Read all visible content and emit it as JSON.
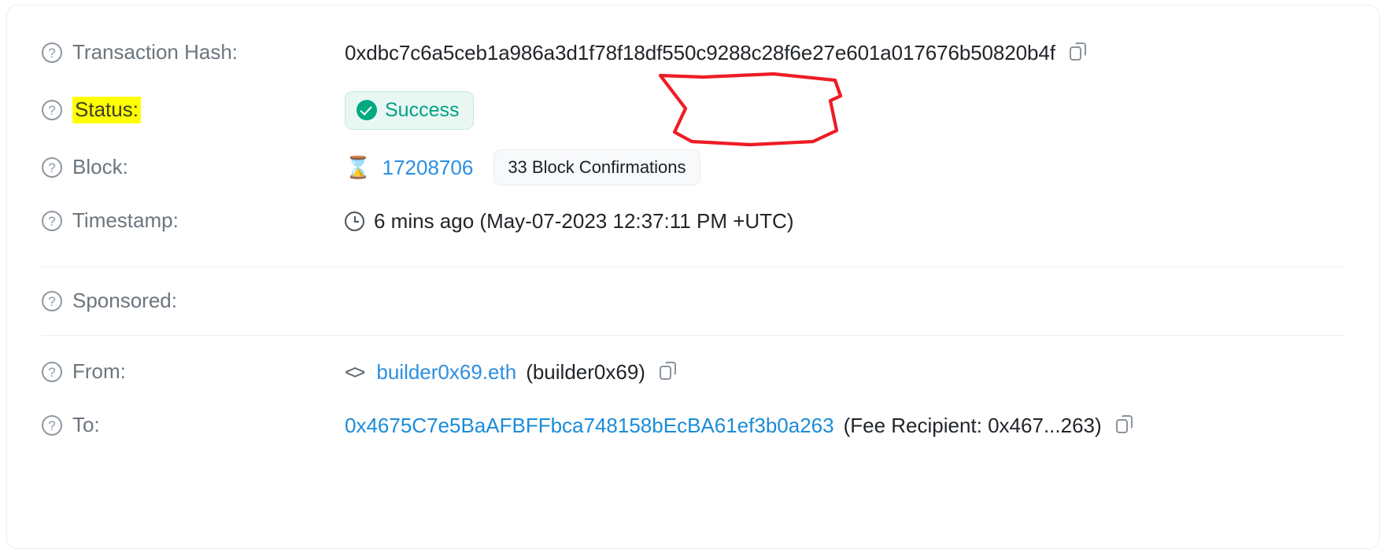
{
  "card": {
    "rows": [
      {
        "id": "transaction-hash",
        "label": "Transaction Hash:",
        "value": "0xdbc7c6a5ceb1a986a3d1f78f18df550c9288c28f6e27e601a017676b50820b4f",
        "help_icon": "question-mark-icon",
        "copy_icon": "copy-icon"
      },
      {
        "id": "status",
        "label": "Status:",
        "badge_text": "Success",
        "badge_icon": "check-circle-icon",
        "highlighted": true
      },
      {
        "id": "block",
        "label": "Block:",
        "number": "17208706",
        "icon": "hourglass-icon",
        "confirmations": "33 Block Confirmations"
      },
      {
        "id": "timestamp",
        "label": "Timestamp:",
        "icon": "clock-icon",
        "value": "6 mins ago (May-07-2023 12:37:11 PM +UTC)"
      },
      {
        "id": "sponsored",
        "label": "Sponsored:",
        "value": ""
      },
      {
        "id": "from",
        "label": "From:",
        "icon": "code-brackets-icon",
        "link": "builder0x69.eth",
        "suffix": "(builder0x69)",
        "copy_icon": "copy-icon"
      },
      {
        "id": "to",
        "label": "To:",
        "link": "0x4675C7e5BaAFBFFbca748158bEcBA61ef3b0a263",
        "suffix": "(Fee Recipient: 0x467...263)",
        "copy_icon": "copy-icon"
      }
    ]
  },
  "annotation": {
    "type": "hand-drawn-circle",
    "color": "#ee1c25",
    "target": "status-success-badge"
  },
  "colors": {
    "link": "#2d8fe0",
    "success_text": "#00a186",
    "success_bg": "#e9f7f3",
    "label": "#6c757d",
    "highlight": "#ffff00",
    "annotation": "#ee1c25"
  },
  "icons": {
    "help": "?",
    "hourglass": "⌛"
  }
}
